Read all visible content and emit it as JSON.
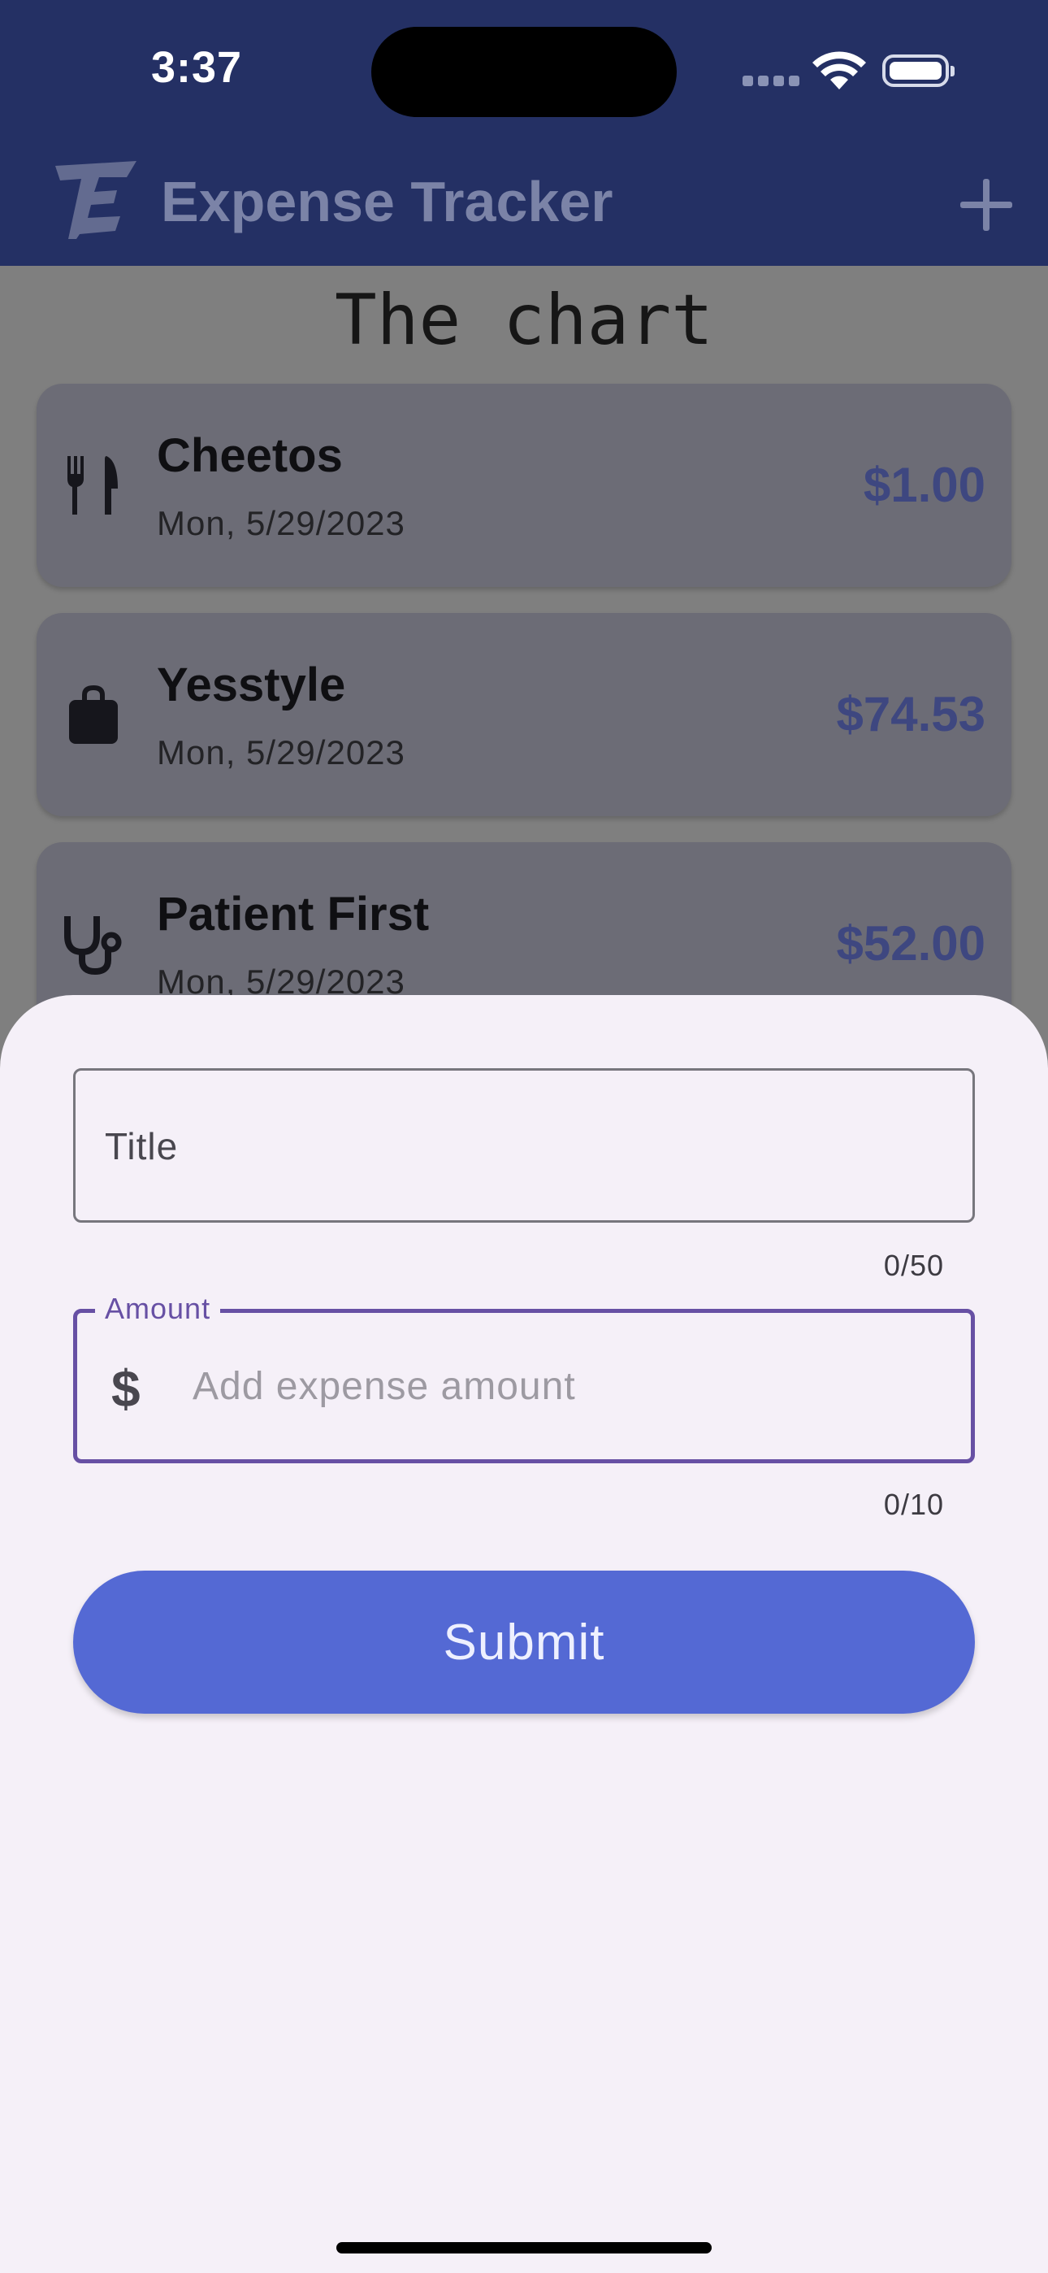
{
  "status_bar": {
    "time": "3:37"
  },
  "app_bar": {
    "title": "Expense Tracker",
    "logo_icon": "expense-tracker-logo-icon",
    "add_icon": "plus-icon"
  },
  "chart": {
    "heading": "The chart"
  },
  "expenses": [
    {
      "title": "Cheetos",
      "date": "Mon, 5/29/2023",
      "amount": "$1.00",
      "icon": "fork-knife-icon"
    },
    {
      "title": "Yesstyle",
      "date": "Mon, 5/29/2023",
      "amount": "$74.53",
      "icon": "shopping-bag-icon"
    },
    {
      "title": "Patient First",
      "date": "Mon, 5/29/2023",
      "amount": "$52.00",
      "icon": "stethoscope-icon"
    }
  ],
  "form": {
    "title_label": "Title",
    "title_counter": "0/50",
    "amount_label": "Amount",
    "amount_placeholder": "Add expense amount",
    "amount_prefix": "$",
    "amount_counter": "0/10",
    "submit_label": "Submit"
  },
  "colors": {
    "app_bar": "#243064",
    "accent": "#6750a4",
    "submit": "#5469d4",
    "sheet": "#f5f0f8"
  }
}
